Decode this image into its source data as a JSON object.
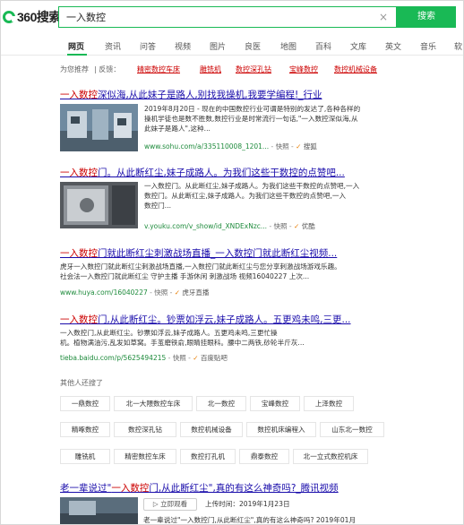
{
  "header": {
    "logo_text": "360搜索",
    "search_value": "一入数控",
    "clear_label": "×",
    "search_button": "搜索"
  },
  "nav": {
    "items": [
      "网页",
      "资讯",
      "问答",
      "视频",
      "图片",
      "良医",
      "地图",
      "百科",
      "文库",
      "英文",
      "音乐",
      "软"
    ]
  },
  "recommend": {
    "label": "为您推荐",
    "feedback": "| 反馈：",
    "links": [
      "精密数控车床",
      "雕铣机",
      "数控深孔钻",
      "宝峰数控",
      "数控机械设备"
    ]
  },
  "results": [
    {
      "title_pre": "一入数控",
      "title_rest": "深似海,从此妹子是路人,别找我操机,我要学编程!_行业",
      "snippet_lines": [
        "2019年8月20日 - 现在的中国数控行业可谓是特别的发达了,各种各样的",
        "操机学徒也是数不胜数,数控行业是时常流行一句话,\"一入数控深似海,从",
        "此妹子是路人\",这种..."
      ],
      "url": "www.sohu.com/a/335110008_1201...",
      "snapshot": "快照",
      "source": "搜狐"
    },
    {
      "title_pre": "一入数控",
      "title_rest": "门。从此断红尘,妹子成路人。为我们这些干数控的点赞吧...",
      "snippet_lines": [
        "一入数控门。从此断红尘,妹子成路人。为我们这些干数控的点赞吧,一入",
        "数控门。从此断红尘,妹子成路人。为我们这些干数控的点赞吧,一入",
        "数控门..."
      ],
      "url": "v.youku.com/v_show/id_XNDExNzc...",
      "snapshot": "快照",
      "source": "优酷"
    },
    {
      "title_pre": "一入数控",
      "title_rest": "门就此断红尘刺激战场直播_一入数控门就此断红尘视频...",
      "snippet_lines": [
        "虎牙一入数控门就此断红尘刺激战场直播,一入数控门就此断红尘与您分享刺激战场游戏乐趣。",
        "社会法一入数控门就此断红尘 守护主播 手游休闲 刺激战场 视频16040227 上次..."
      ],
      "url": "www.huya.com/16040227",
      "snapshot": "快照",
      "source": "虎牙直播"
    },
    {
      "title_pre": "一入数控",
      "title_rest": "门,从此断红尘。钞票如浮云,妹子成路人。五更鸡未鸣,三更...",
      "snippet_lines": [
        "一入数控门,从此断红尘。钞票如浮云,妹子成路人。五更鸡未鸣,三更忙操",
        "机。植物满油污,乱发如草窝。手茧磨铁俞,眼睛挂眼科。腰中二两铁,砂轮半斤灰..."
      ],
      "url": "tieba.baidu.com/p/5625494215",
      "snapshot": "快照",
      "source": "百度贴吧"
    }
  ],
  "related": {
    "title": "其他人还搜了",
    "rows": [
      [
        "一鼎数控",
        "北一大隈数控车床",
        "北一数控",
        "宝峰数控",
        "上泽数控"
      ],
      [
        "精啄数控",
        "数控深孔钻",
        "数控机械设备",
        "数控机床编程入",
        "山东北一数控"
      ],
      [
        "雕铣机",
        "精密数控车床",
        "数控打孔机",
        "鼎泰数控",
        "北一立式数控机床"
      ]
    ]
  },
  "last_result": {
    "title_pre": "老一辈说过\"",
    "title_hl": "一入数控",
    "title_rest": "门,从此断红尘\",真的有这么神奇吗?_腾讯视频",
    "video_button": "▷ 立即观看",
    "meta": "上传时间：2019年1月23日",
    "snippet": "老一辈说过\"一入数控门,从此断红尘\",真的有这么神奇吗? 2019年01月"
  },
  "colors": {
    "accent": "#19b955",
    "link": "#1a0dab",
    "highlight": "#cc0000",
    "url": "#1e8b3c"
  }
}
